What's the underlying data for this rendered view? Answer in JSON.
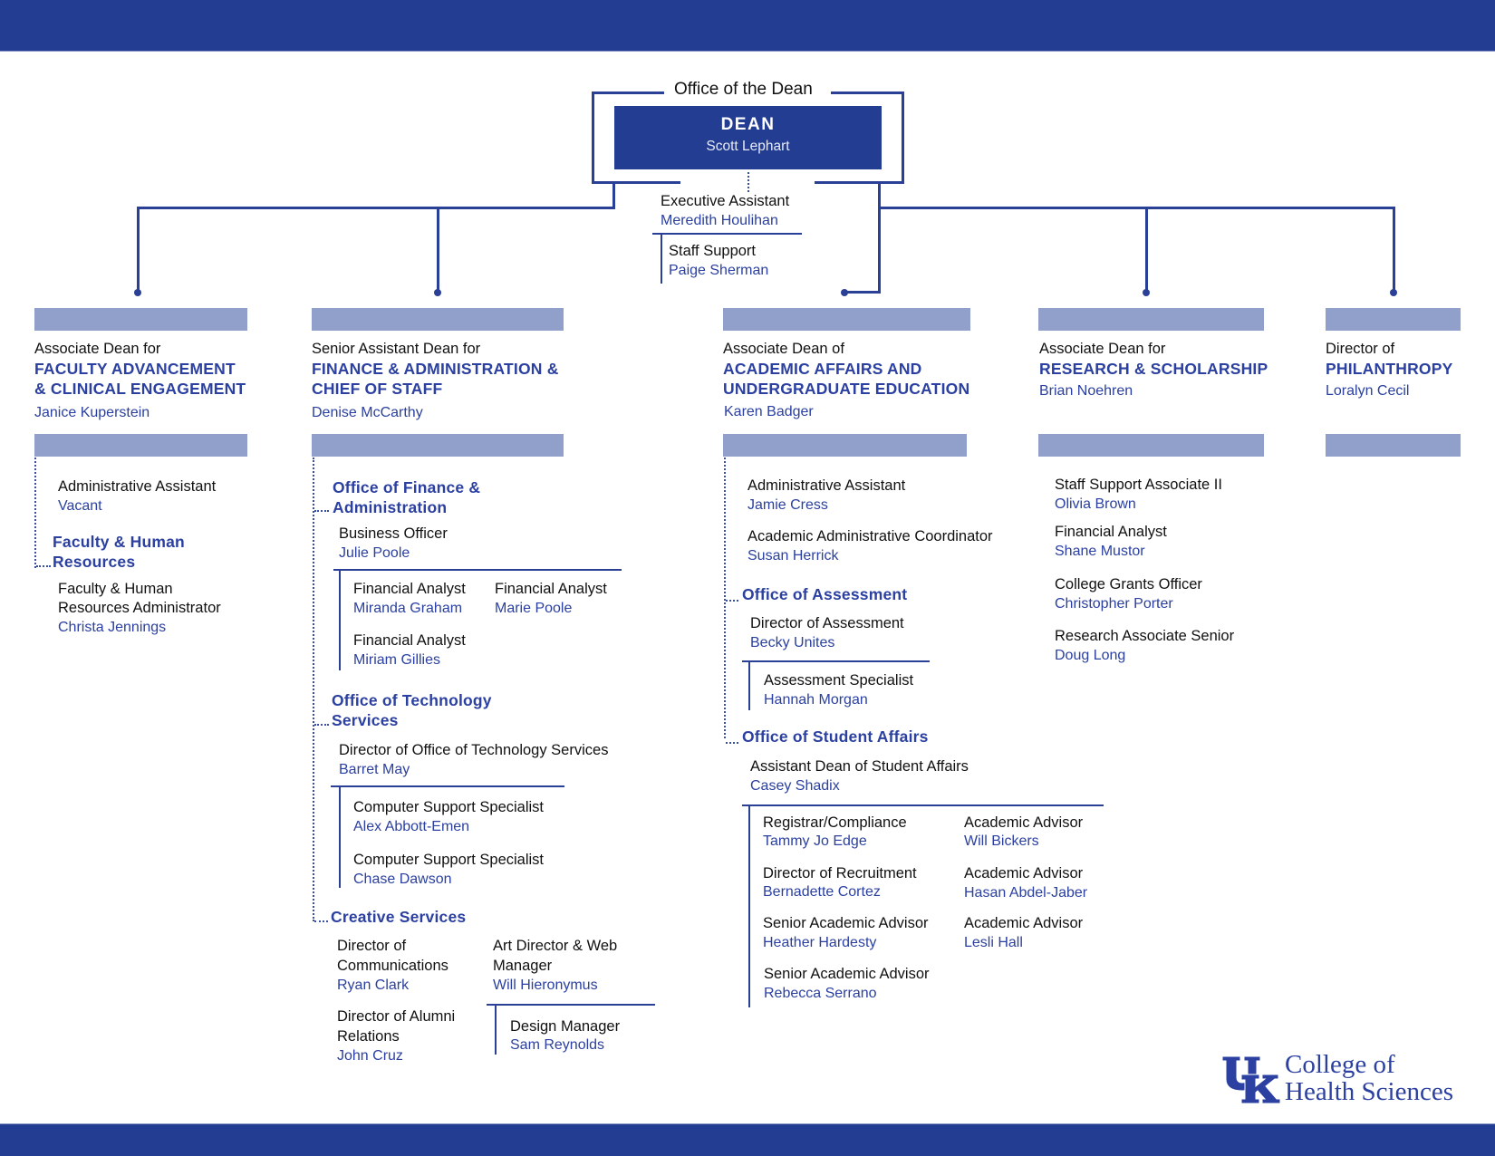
{
  "office_label": "Office of the Dean",
  "dean": {
    "title": "DEAN",
    "name": "Scott Lephart"
  },
  "exec_assistant": {
    "role": "Executive Assistant",
    "name": "Meredith Houlihan"
  },
  "staff_support": {
    "role": "Staff Support",
    "name": "Paige Sherman"
  },
  "colors": {
    "brand": "#233d92",
    "accent_bar": "#919fcb",
    "name_text": "#2b40a0"
  },
  "divisions": {
    "faculty": {
      "prefix": "Associate Dean for",
      "title_lines": [
        "FACULTY ADVANCEMENT",
        "& CLINICAL ENGAGEMENT"
      ],
      "leader": "Janice Kuperstein",
      "staff": [
        {
          "role": "Administrative Assistant",
          "name": "Vacant"
        }
      ],
      "units": [
        {
          "title_lines": [
            "Faculty & Human",
            "Resources"
          ],
          "staff": [
            {
              "role_lines": [
                "Faculty & Human",
                "Resources Administrator"
              ],
              "name": "Christa Jennings"
            }
          ]
        }
      ]
    },
    "finance": {
      "prefix": "Senior Assistant Dean for",
      "title_lines": [
        "FINANCE & ADMINISTRATION &",
        "CHIEF OF STAFF"
      ],
      "leader": "Denise McCarthy",
      "units": [
        {
          "title_lines": [
            "Office of Finance &",
            "Administration"
          ],
          "head": {
            "role": "Business Officer",
            "name": "Julie Poole"
          },
          "reports": [
            {
              "role": "Financial Analyst",
              "name": "Miranda Graham"
            },
            {
              "role": "Financial Analyst",
              "name": "Marie Poole"
            },
            {
              "role": "Financial Analyst",
              "name": "Miriam Gillies"
            }
          ]
        },
        {
          "title_lines": [
            "Office of Technology",
            "Services"
          ],
          "head": {
            "role": "Director of Office of Technology Services",
            "name": "Barret May"
          },
          "reports": [
            {
              "role": "Computer Support Specialist",
              "name": "Alex Abbott-Emen"
            },
            {
              "role": "Computer Support Specialist",
              "name": "Chase Dawson"
            }
          ]
        },
        {
          "title": "Creative Services",
          "staff": [
            {
              "role_lines": [
                "Director of",
                "Communications"
              ],
              "name": "Ryan Clark"
            },
            {
              "role_lines": [
                "Art Director & Web",
                "Manager"
              ],
              "name": "Will Hieronymus"
            },
            {
              "role_lines": [
                "Director of Alumni",
                "Relations"
              ],
              "name": "John Cruz"
            }
          ],
          "reports": [
            {
              "role": "Design Manager",
              "name": "Sam Reynolds"
            }
          ]
        }
      ]
    },
    "academic": {
      "prefix": "Associate Dean of",
      "title_lines": [
        "ACADEMIC AFFAIRS AND",
        "UNDERGRADUATE EDUCATION"
      ],
      "leader": "Karen Badger",
      "staff": [
        {
          "role": "Administrative Assistant",
          "name": "Jamie Cress"
        },
        {
          "role": "Academic Administrative Coordinator",
          "name": "Susan Herrick"
        }
      ],
      "units": [
        {
          "title": "Office of Assessment",
          "head": {
            "role": "Director of Assessment",
            "name": "Becky Unites"
          },
          "reports": [
            {
              "role": "Assessment Specialist",
              "name": "Hannah Morgan"
            }
          ]
        },
        {
          "title": "Office of Student Affairs",
          "head": {
            "role": "Assistant Dean of Student Affairs",
            "name": "Casey Shadix"
          },
          "reports": [
            {
              "role": "Registrar/Compliance",
              "name": "Tammy Jo Edge"
            },
            {
              "role": "Academic Advisor",
              "name": "Will Bickers"
            },
            {
              "role": "Director of Recruitment",
              "name": "Bernadette Cortez"
            },
            {
              "role": "Academic Advisor",
              "name": "Hasan Abdel-Jaber"
            },
            {
              "role": "Senior Academic Advisor",
              "name": "Heather Hardesty"
            },
            {
              "role": "Academic Advisor",
              "name": "Lesli Hall"
            },
            {
              "role": "Senior Academic Advisor",
              "name": "Rebecca Serrano"
            }
          ]
        }
      ]
    },
    "research": {
      "prefix": "Associate Dean for",
      "title_lines": [
        "RESEARCH & SCHOLARSHIP"
      ],
      "leader": "Brian Noehren",
      "staff": [
        {
          "role": "Staff Support Associate II",
          "name": "Olivia Brown"
        },
        {
          "role": "Financial Analyst",
          "name": "Shane Mustor"
        },
        {
          "role": "College Grants Officer",
          "name": "Christopher Porter"
        },
        {
          "role": "Research Associate Senior",
          "name": "Doug Long"
        }
      ]
    },
    "philanthropy": {
      "prefix": "Director of",
      "title_lines": [
        "PHILANTHROPY"
      ],
      "leader": "Loralyn Cecil"
    }
  },
  "logo": {
    "mark": "UK",
    "line1": "College of",
    "line2": "Health Sciences"
  }
}
